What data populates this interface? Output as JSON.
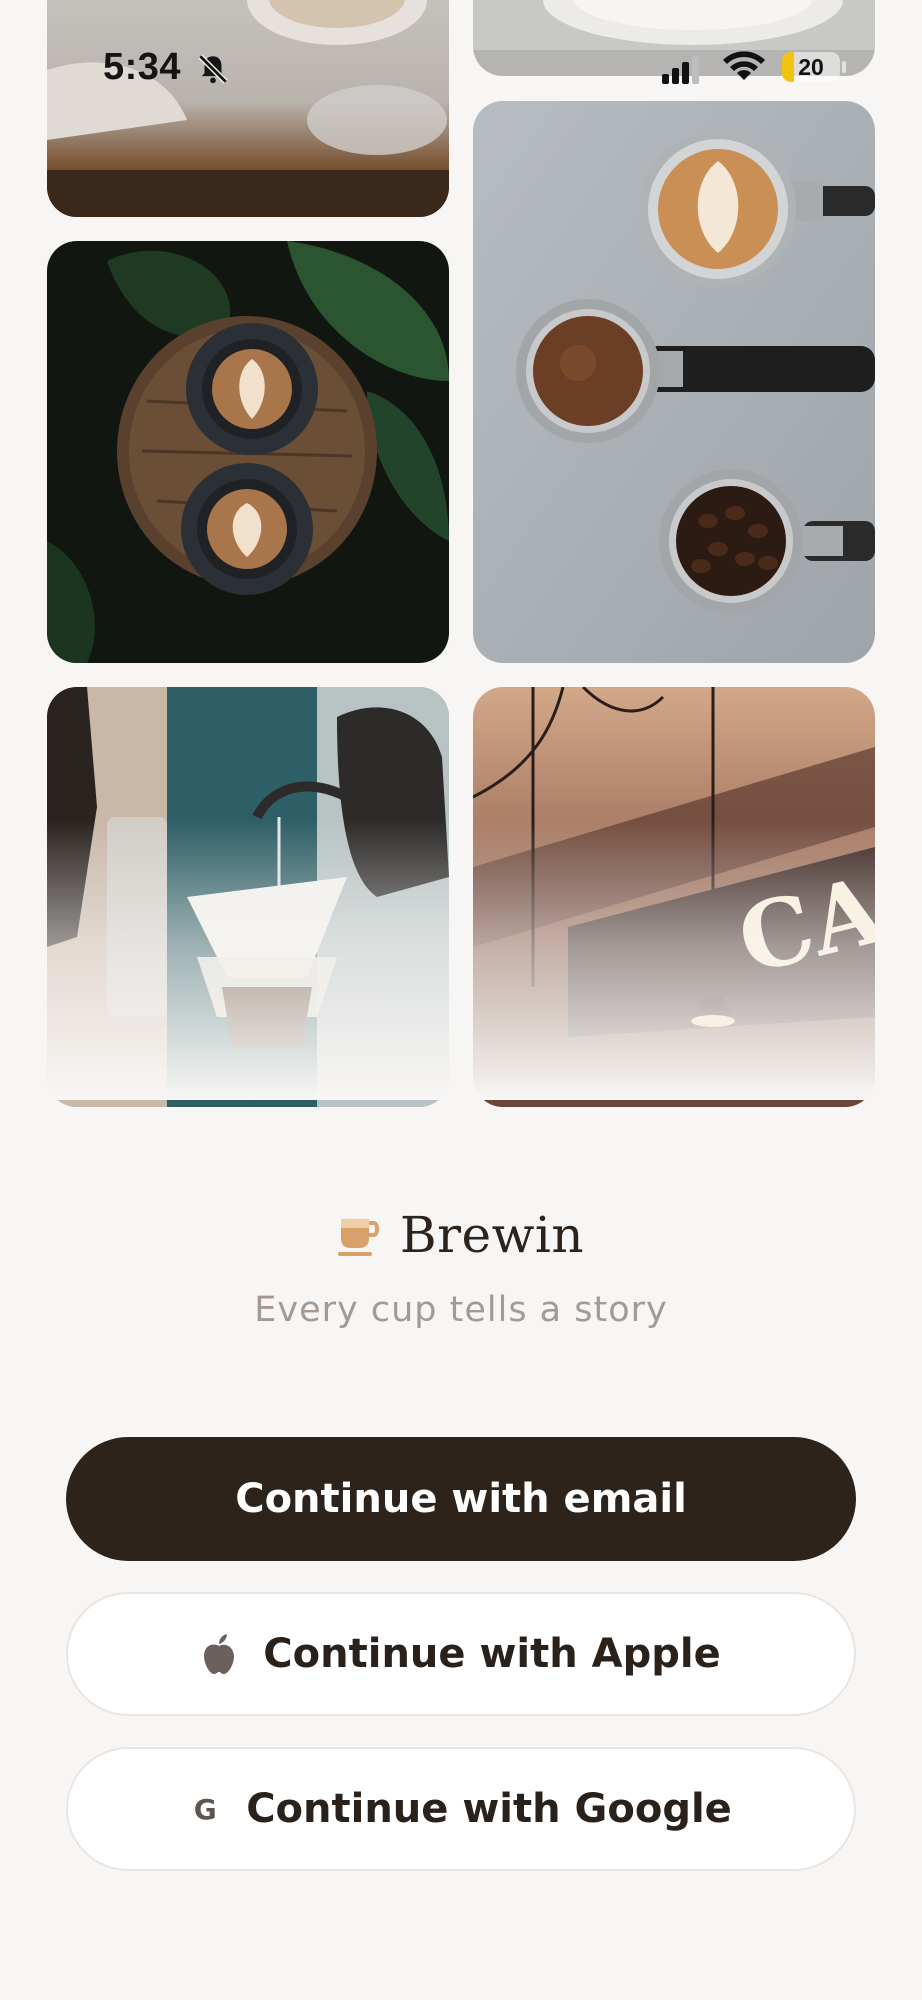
{
  "status_bar": {
    "time": "5:34",
    "battery_level": "20",
    "battery_fraction": 0.2,
    "battery_color": "#f1c40f"
  },
  "gallery": {
    "photos": [
      {
        "subject": "coffee cups on wooden table (cropped)"
      },
      {
        "subject": "latte cup on saucer (cropped)"
      },
      {
        "subject": "two lattes on round wooden board among plants"
      },
      {
        "subject": "three espresso portafilters with latte, ground coffee and beans"
      },
      {
        "subject": "pour-over coffee with gooseneck kettle"
      },
      {
        "subject": "cafe interior with illuminated sign"
      }
    ],
    "sign_text": "CA"
  },
  "brand": {
    "name": "Brewin",
    "tagline": "Every cup tells a story",
    "icon": "coffee-cup-icon",
    "accent_color": "#d9a06a"
  },
  "actions": {
    "email_label": "Continue with email",
    "apple_label": "Continue with Apple",
    "google_label": "Continue with Google",
    "google_glyph": "G",
    "apple_icon": "apple-icon",
    "primary_color": "#2d231b"
  }
}
